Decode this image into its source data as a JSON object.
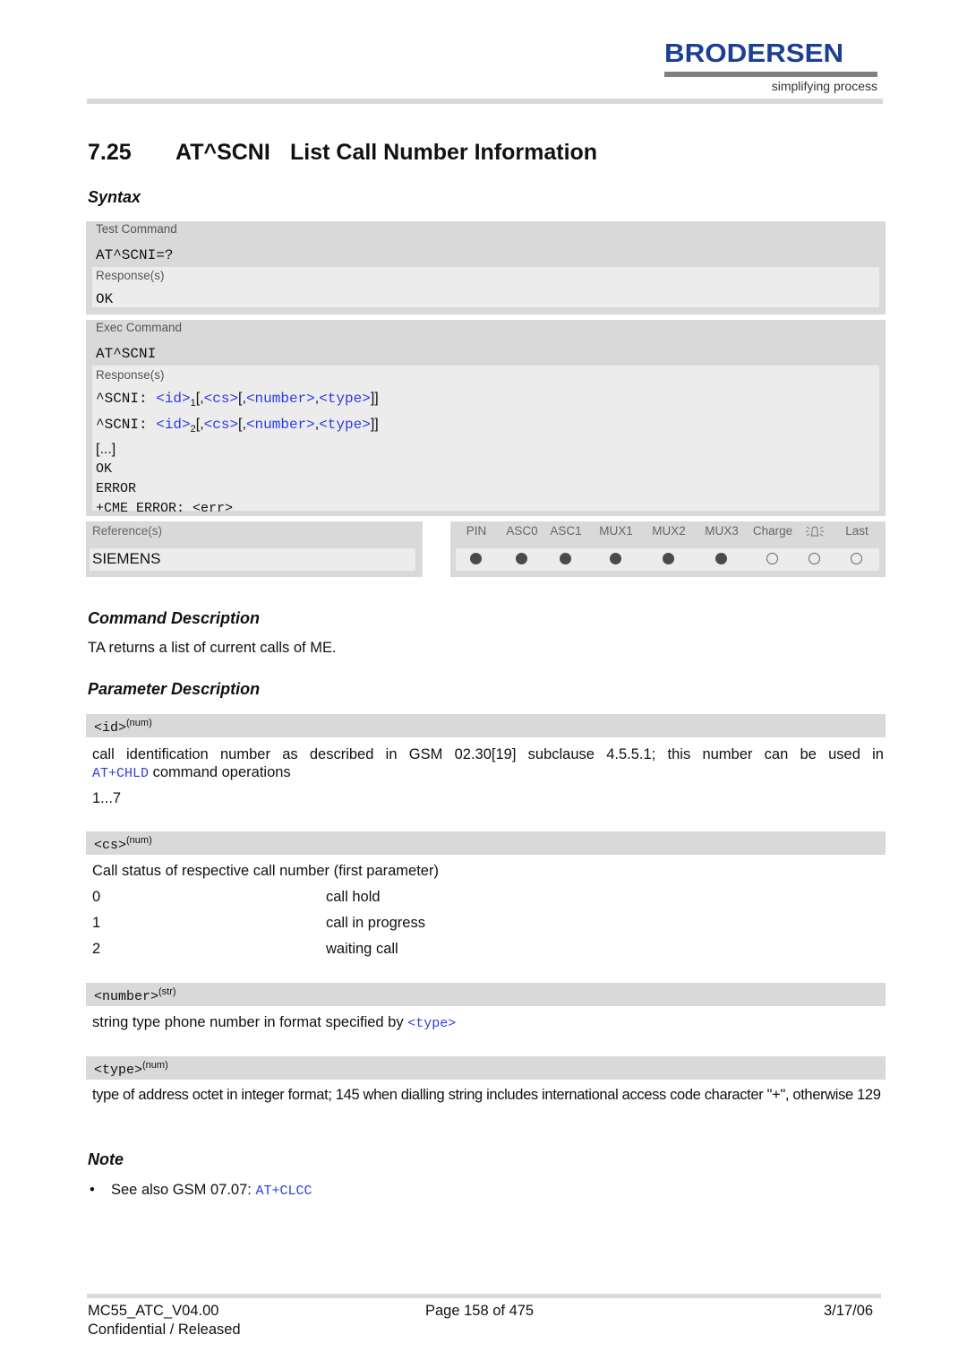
{
  "header": {
    "logo_text": "BRODERSEN",
    "logo_tagline": "simplifying process"
  },
  "section": {
    "number": "7.25",
    "command": "AT^SCNI",
    "title": "List Call Number Information"
  },
  "syntax": {
    "heading": "Syntax",
    "test_command": {
      "label": "Test Command",
      "command": "AT^SCNI=?",
      "responses_label": "Response(s)",
      "responses": [
        "OK"
      ]
    },
    "exec_command": {
      "label": "Exec Command",
      "command": "AT^SCNI",
      "responses_label": "Response(s)",
      "response_lines": [
        {
          "prefix": "^SCNI: ",
          "id": "<id>",
          "sub": "1",
          "p1": "[,",
          "cs": "<cs>",
          "p2": "[,",
          "number": "<number>",
          "p3": ",",
          "type": "<type>",
          "p4": "]]"
        },
        {
          "prefix": "^SCNI: ",
          "id": "<id>",
          "sub": "2",
          "p1": "[,",
          "cs": "<cs>",
          "p2": "[,",
          "number": "<number>",
          "p3": ",",
          "type": "<type>",
          "p4": "]]"
        }
      ],
      "ellipsis": "[...]",
      "trailing": [
        "OK",
        "ERROR",
        "+CME ERROR: <err>"
      ]
    },
    "references": {
      "label": "Reference(s)",
      "value": "SIEMENS"
    },
    "status_table": {
      "columns": [
        {
          "label": "PIN",
          "state": "filled"
        },
        {
          "label": "ASC0",
          "state": "filled"
        },
        {
          "label": "ASC1",
          "state": "filled"
        },
        {
          "label": "MUX1",
          "state": "filled"
        },
        {
          "label": "MUX2",
          "state": "filled"
        },
        {
          "label": "MUX3",
          "state": "filled"
        },
        {
          "label": "Charge",
          "state": "empty"
        },
        {
          "label": "",
          "icon": "alarm-bell-icon",
          "state": "empty"
        },
        {
          "label": "Last",
          "state": "empty"
        }
      ]
    }
  },
  "command_description": {
    "heading": "Command Description",
    "text": "TA returns a list of current calls of ME."
  },
  "parameter_description": {
    "heading": "Parameter Description",
    "params": [
      {
        "name": "<id>",
        "type": "(num)",
        "desc_before": "call identification number as described in GSM 02.30[19] subclause 4.5.5.1; this number can be used in",
        "desc_link": "AT+CHLD",
        "desc_after": " command operations",
        "range": "1...7"
      },
      {
        "name": "<cs>",
        "type": "(num)",
        "desc": "Call status of respective call number (first parameter)",
        "values": [
          {
            "value": "0",
            "meaning": "call hold"
          },
          {
            "value": "1",
            "meaning": "call in progress"
          },
          {
            "value": "2",
            "meaning": "waiting call"
          }
        ]
      },
      {
        "name": "<number>",
        "type": "(str)",
        "desc_before": "string type phone number in format specified by ",
        "desc_link": "<type>"
      },
      {
        "name": "<type>",
        "type": "(num)",
        "desc": "type of address octet in integer format; 145 when dialling string includes international access code character \"+\", otherwise 129"
      }
    ]
  },
  "note": {
    "heading": "Note",
    "bullet": "•",
    "text_before": "See also GSM 07.07: ",
    "link": "AT+CLCC"
  },
  "footer": {
    "doc_id": "MC55_ATC_V04.00",
    "page": "Page 158 of 475",
    "date": "3/17/06",
    "classification": "Confidential / Released"
  }
}
